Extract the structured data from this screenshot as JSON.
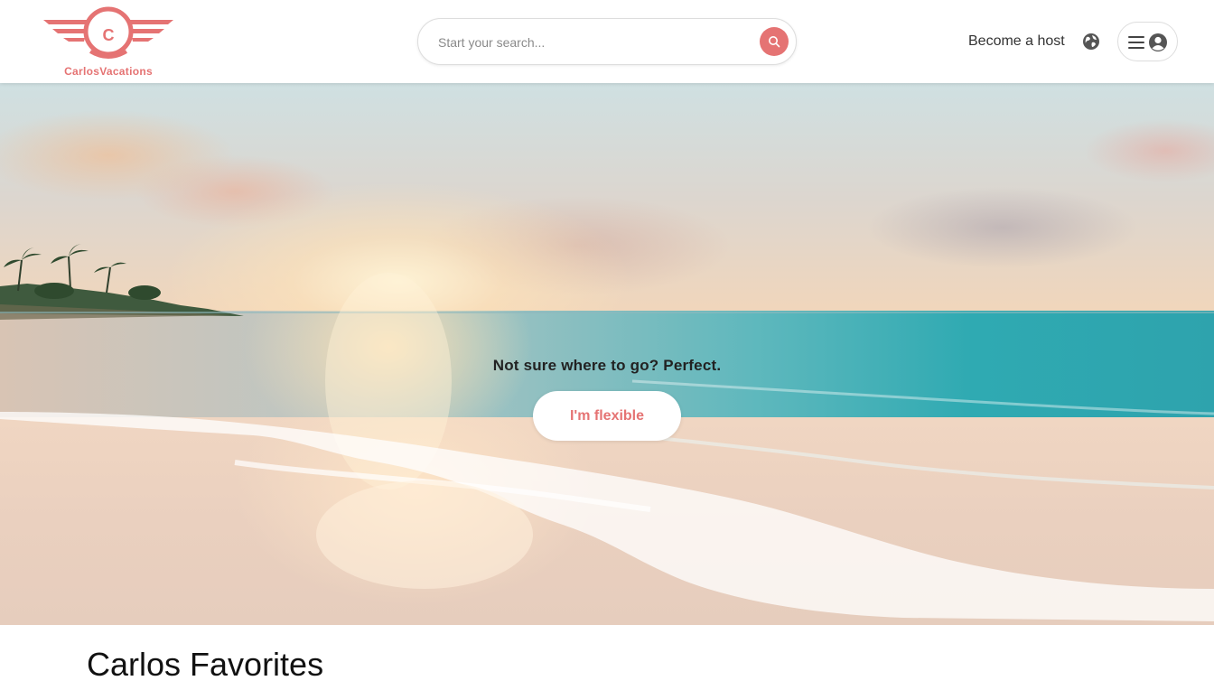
{
  "header": {
    "logo_letter": "C",
    "logo_text": "CarlosVacations",
    "search_placeholder": "Start your search...",
    "host_link": "Become a host"
  },
  "hero": {
    "tagline": "Not sure where to go? Perfect.",
    "button_label": "I'm flexible"
  },
  "section": {
    "title": "Carlos Favorites"
  },
  "colors": {
    "brand": "#e57373",
    "text": "#222222"
  },
  "icons": {
    "search_button": "search-icon",
    "language": "globe-icon",
    "menu": "hamburger-icon",
    "profile": "user-avatar-icon"
  }
}
